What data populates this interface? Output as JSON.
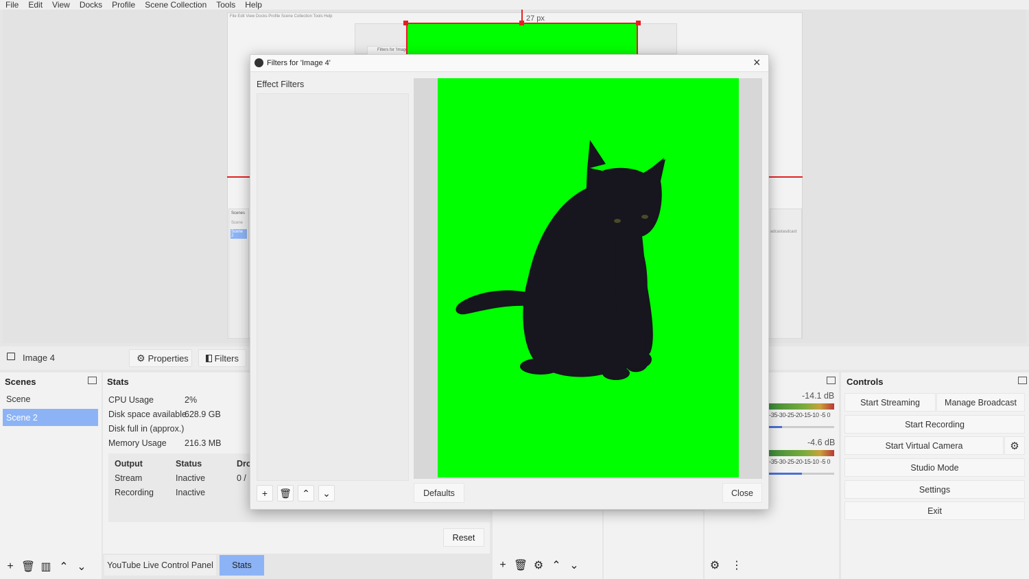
{
  "menu": [
    "File",
    "Edit",
    "View",
    "Docks",
    "Profile",
    "Scene Collection",
    "Tools",
    "Help"
  ],
  "preview": {
    "size_label": "27 px",
    "nested_menu": "File   Edit   View   Docks   Profile   Scene Collection   Tools   Help",
    "nested_scenes": [
      "Scenes",
      "Scene",
      "Scene 2"
    ],
    "nested_dialog_title": "Filters for 'Image"
  },
  "source_toolbar": {
    "source_name": "Image 4",
    "properties_label": "Properties",
    "filters_label": "Filters"
  },
  "scenes": {
    "title": "Scenes",
    "items": [
      "Scene",
      "Scene 2"
    ],
    "selected_index": 1
  },
  "stats": {
    "title": "Stats",
    "rows": [
      {
        "label": "CPU Usage",
        "value": "2%"
      },
      {
        "label": "Disk space available",
        "value": "628.9 GB"
      },
      {
        "label": "Disk full in (approx.)",
        "value": ""
      },
      {
        "label": "Memory Usage",
        "value": "216.3 MB"
      }
    ],
    "table_headers": [
      "Output",
      "Status",
      "Dro"
    ],
    "table_rows": [
      {
        "output": "Stream",
        "status": "Inactive",
        "dropped": "0 /"
      },
      {
        "output": "Recording",
        "status": "Inactive",
        "dropped": ""
      }
    ],
    "reset_label": "Reset"
  },
  "bottom_tabs": [
    {
      "label": "YouTube Live Control Panel",
      "active": false
    },
    {
      "label": "Stats",
      "active": true
    }
  ],
  "audio_mixer": {
    "channels": [
      {
        "db": "-14.1 dB",
        "scale": "-35-30-25-20-15-10 -5  0",
        "volume_fraction": 0.2
      },
      {
        "db": "-4.6 dB",
        "scale": "-35-30-25-20-15-10 -5  0",
        "volume_fraction": 0.5
      }
    ],
    "partial_text": "adcastasdcast"
  },
  "controls": {
    "title": "Controls",
    "start_streaming": "Start Streaming",
    "manage_broadcast": "Manage Broadcast",
    "start_recording": "Start Recording",
    "start_virtual_camera": "Start Virtual Camera",
    "studio_mode": "Studio Mode",
    "settings": "Settings",
    "exit": "Exit"
  },
  "dialog": {
    "title": "Filters for 'Image 4'",
    "effect_filters_label": "Effect Filters",
    "defaults_label": "Defaults",
    "close_label": "Close"
  },
  "colors": {
    "accent_selected": "#8cb3f5",
    "chroma_green": "#00ff00",
    "selection_red": "#e42020"
  }
}
